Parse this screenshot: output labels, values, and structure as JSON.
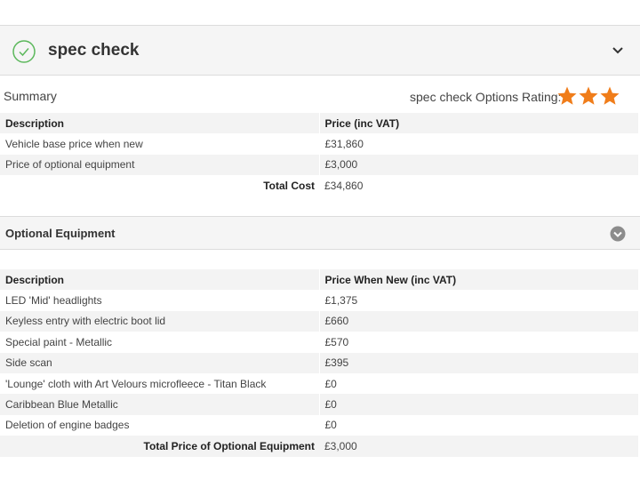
{
  "header": {
    "title": "spec check"
  },
  "summary": {
    "label": "Summary",
    "rating_label": "spec check Options Rating:",
    "rating_stars": 3,
    "columns": [
      "Description",
      "Price (inc VAT)"
    ],
    "rows": [
      {
        "description": "Vehicle base price when new",
        "price": "£31,860"
      },
      {
        "description": "Price of optional equipment",
        "price": "£3,000"
      }
    ],
    "total_label": "Total Cost",
    "total_value": "£34,860"
  },
  "optional": {
    "title": "Optional Equipment",
    "columns": [
      "Description",
      "Price When New (inc VAT)"
    ],
    "rows": [
      {
        "description": "LED 'Mid' headlights",
        "price": "£1,375"
      },
      {
        "description": "Keyless entry with electric boot lid",
        "price": "£660"
      },
      {
        "description": "Special paint - Metallic",
        "price": "£570"
      },
      {
        "description": "Side scan",
        "price": "£395"
      },
      {
        "description": "'Lounge' cloth with Art Velours microfleece - Titan Black",
        "price": "£0"
      },
      {
        "description": "Caribbean Blue Metallic",
        "price": "£0"
      },
      {
        "description": "Deletion of engine badges",
        "price": "£0"
      }
    ],
    "total_label": "Total Price of Optional Equipment",
    "total_value": "£3,000"
  },
  "colors": {
    "accent_green": "#5cb85c",
    "star_orange": "#f07d1a",
    "toggle_grey": "#8c8c8c"
  },
  "icons": {
    "header_status": "check-circle-icon",
    "header_toggle": "chevron-down-icon",
    "section_toggle": "chevron-circle-icon",
    "rating": "star-icon"
  }
}
